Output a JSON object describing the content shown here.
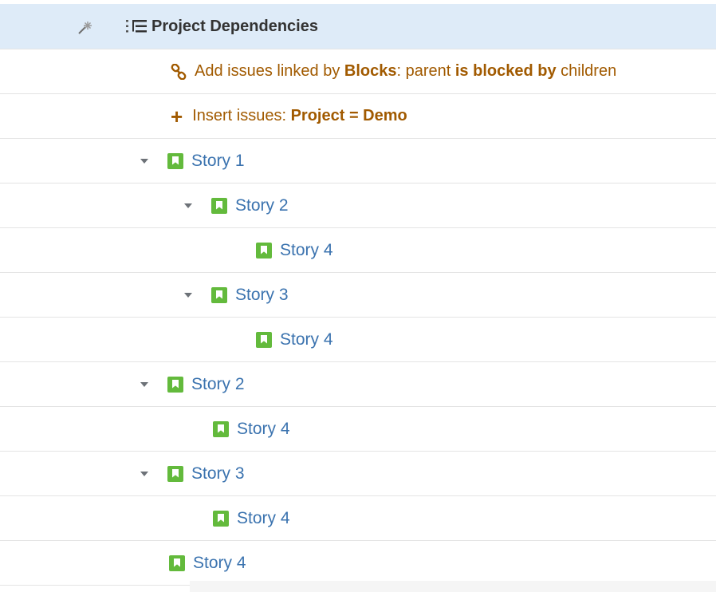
{
  "header": {
    "title": "Project Dependencies",
    "wand_icon": "magic-wand-icon",
    "list_icon": "structure-list-icon"
  },
  "generators": [
    {
      "icon": "link-icon",
      "parts": [
        "Add issues linked by ",
        "Blocks",
        ": parent ",
        "is blocked by",
        " children"
      ]
    },
    {
      "icon": "plus-icon",
      "parts": [
        "Insert issues: ",
        "Project = Demo"
      ]
    }
  ],
  "rows": [
    {
      "label": "Story 1",
      "expanded": true
    },
    {
      "label": "Story 2",
      "expanded": true
    },
    {
      "label": "Story 4",
      "expanded": false
    },
    {
      "label": "Story 3",
      "expanded": true
    },
    {
      "label": "Story 4",
      "expanded": false
    },
    {
      "label": "Story 2",
      "expanded": true
    },
    {
      "label": "Story 4",
      "expanded": false
    },
    {
      "label": "Story 3",
      "expanded": true
    },
    {
      "label": "Story 4",
      "expanded": false
    },
    {
      "label": "Story 4",
      "expanded": false
    }
  ],
  "colors": {
    "header_bg": "#deebf8",
    "generator_text": "#a15a00",
    "story_link": "#3b73af",
    "story_icon": "#63ba3c"
  }
}
